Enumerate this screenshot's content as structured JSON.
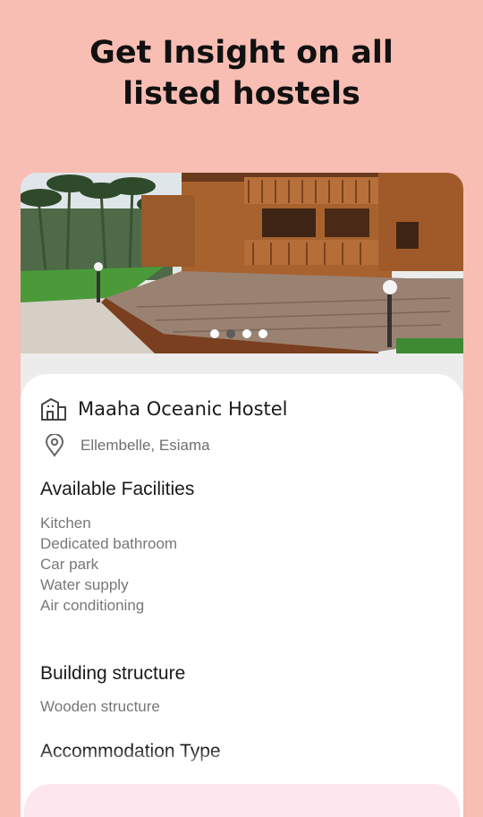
{
  "headline": {
    "line1": "Get Insight on all",
    "line2": "listed hostels"
  },
  "carousel": {
    "image_alt": "Wooden hostel building with deck",
    "dots": [
      {
        "active": false
      },
      {
        "active": true
      },
      {
        "active": false
      },
      {
        "active": false
      }
    ]
  },
  "hostel": {
    "name": "Maaha Oceanic Hostel",
    "location": "Ellembelle, Esiama"
  },
  "facilities": {
    "heading": "Available Facilities",
    "items": [
      "Kitchen",
      "Dedicated bathroom",
      "Car park",
      "Water supply",
      "Air conditioning"
    ]
  },
  "structure": {
    "heading": "Building structure",
    "value": "Wooden structure"
  },
  "accommodation": {
    "heading": "Accommodation Type"
  },
  "colors": {
    "background": "#f8bdb3",
    "bottom_bar": "#fde6ee"
  },
  "icons": {
    "building": "building-icon",
    "location": "location-pin-icon"
  }
}
